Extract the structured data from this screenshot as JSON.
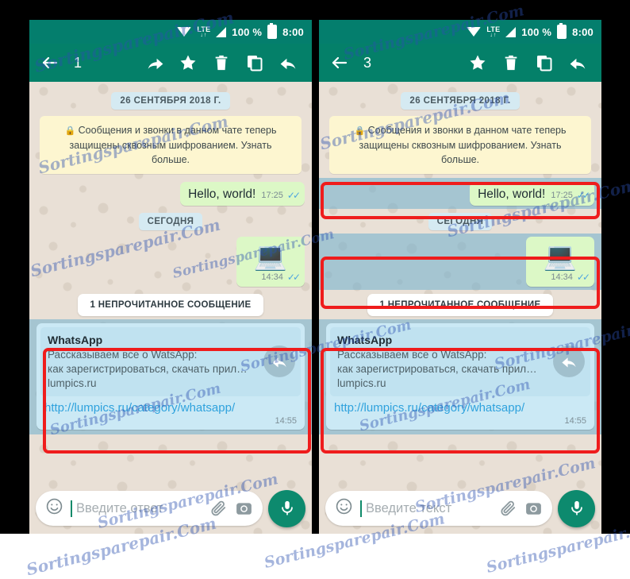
{
  "meta": {
    "app": "WhatsApp",
    "watermark_text": "Sortingsparepair.Com"
  },
  "colors": {
    "toolbar": "#048069",
    "statusbar": "#047e6d",
    "outgoing_bubble": "#dcf8c6",
    "incoming_bubble": "#cbe9f5",
    "system_bubble": "#fdf6d0",
    "date_pill": "#d5eaf2",
    "highlight_red": "#ef1c1c",
    "selection_band": "#6eafcd",
    "link_blue": "#2fa2dd",
    "mic_green": "#0d8a6e"
  },
  "statusbar": {
    "wifi_icon": "wifi-icon",
    "network_label": "LTE",
    "network_arrows": "↓↑",
    "signal_icon": "signal-bars-icon",
    "battery_text": "100 %",
    "battery_icon": "battery-full-icon",
    "clock": "8:00"
  },
  "panels": [
    {
      "id": "left",
      "toolbar": {
        "back_icon": "back-arrow-icon",
        "selection_count": "1",
        "actions": [
          {
            "name": "reply-button",
            "icon": "reply-arrow-icon"
          },
          {
            "name": "star-button",
            "icon": "star-icon"
          },
          {
            "name": "delete-button",
            "icon": "trash-icon"
          },
          {
            "name": "copy-button",
            "icon": "copy-icon"
          },
          {
            "name": "forward-button",
            "icon": "forward-arrow-icon"
          }
        ]
      },
      "chat": {
        "date_pill": "26 СЕНТЯБРЯ 2018 Г.",
        "system_message": "Сообщения и звонки в данном чате теперь защищены сквозным шифрованием. Узнать больше.",
        "system_lock_icon": "lock-icon",
        "outgoing_text": "Hello, world!",
        "outgoing_time": "17:25",
        "today_pill": "СЕГОДНЯ",
        "image_emoji": "💻",
        "image_time": "14:34",
        "unread_divider": "1 НЕПРОЧИТАННОЕ СООБЩЕНИЕ",
        "link_card": {
          "title": "WhatsApp",
          "description_line1": "Рассказываем все о WatsApp:",
          "description_line2": "как зарегистрироваться, скачать прил…",
          "site": "lumpics.ru",
          "url": "http://lumpics.ru/category/whatsapp/",
          "time": "14:55",
          "forward_icon": "forward-arrow-icon"
        }
      },
      "input": {
        "emoji_icon": "emoji-smiley-icon",
        "placeholder": "Введите ответ",
        "attach_icon": "paperclip-icon",
        "camera_icon": "camera-icon",
        "mic_icon": "microphone-icon"
      },
      "selected_items": [
        "link-card-message"
      ]
    },
    {
      "id": "right",
      "toolbar": {
        "back_icon": "back-arrow-icon",
        "selection_count": "3",
        "actions": [
          {
            "name": "star-button",
            "icon": "star-icon"
          },
          {
            "name": "delete-button",
            "icon": "trash-icon"
          },
          {
            "name": "copy-button",
            "icon": "copy-icon"
          },
          {
            "name": "forward-button",
            "icon": "forward-arrow-icon"
          }
        ]
      },
      "chat": {
        "date_pill": "26 СЕНТЯБРЯ 2018 Г.",
        "system_message": "Сообщения и звонки в данном чате теперь защищены сквозным шифрованием. Узнать больше.",
        "system_lock_icon": "lock-icon",
        "outgoing_text": "Hello, world!",
        "outgoing_time": "17:25",
        "today_pill": "СЕГОДНЯ",
        "image_emoji": "💻",
        "image_time": "14:34",
        "unread_divider": "1 НЕПРОЧИТАННОЕ СООБЩЕНИЕ",
        "link_card": {
          "title": "WhatsApp",
          "description_line1": "Рассказываем все о WatsApp:",
          "description_line2": "как зарегистрироваться, скачать прил…",
          "site": "lumpics.ru",
          "url": "http://lumpics.ru/category/whatsapp/",
          "time": "14:55",
          "forward_icon": "forward-arrow-icon"
        }
      },
      "input": {
        "emoji_icon": "emoji-smiley-icon",
        "placeholder": "Введите текст",
        "attach_icon": "paperclip-icon",
        "camera_icon": "camera-icon",
        "mic_icon": "microphone-icon"
      },
      "selected_items": [
        "text-message",
        "image-message",
        "link-card-message"
      ]
    }
  ]
}
